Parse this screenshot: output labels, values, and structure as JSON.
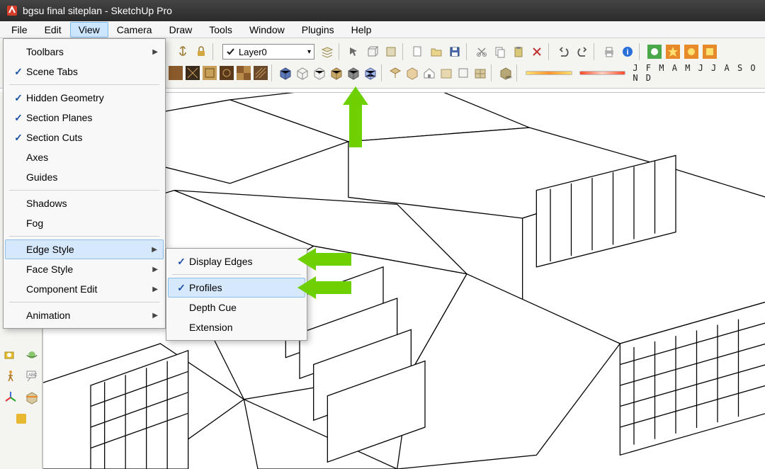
{
  "titlebar": {
    "text": "bgsu final siteplan - SketchUp Pro"
  },
  "menubar": {
    "items": [
      "File",
      "Edit",
      "View",
      "Camera",
      "Draw",
      "Tools",
      "Window",
      "Plugins",
      "Help"
    ],
    "active": "View"
  },
  "layer": {
    "selected": "Layer0"
  },
  "months": "J F M A M J J A S O N D",
  "view_menu": {
    "items": [
      {
        "label": "Toolbars",
        "checked": false,
        "submenu": true
      },
      {
        "label": "Scene Tabs",
        "checked": true
      },
      {
        "sep": true
      },
      {
        "label": "Hidden Geometry",
        "checked": true
      },
      {
        "label": "Section Planes",
        "checked": true
      },
      {
        "label": "Section Cuts",
        "checked": true
      },
      {
        "label": "Axes",
        "checked": false
      },
      {
        "label": "Guides",
        "checked": false
      },
      {
        "sep": true
      },
      {
        "label": "Shadows",
        "checked": false
      },
      {
        "label": "Fog",
        "checked": false
      },
      {
        "sep": true
      },
      {
        "label": "Edge Style",
        "checked": false,
        "submenu": true,
        "hover": true
      },
      {
        "label": "Face Style",
        "checked": false,
        "submenu": true
      },
      {
        "label": "Component Edit",
        "checked": false,
        "submenu": true
      },
      {
        "sep": true
      },
      {
        "label": "Animation",
        "checked": false,
        "submenu": true
      }
    ]
  },
  "edge_submenu": {
    "items": [
      {
        "label": "Display Edges",
        "checked": true
      },
      {
        "sep": true
      },
      {
        "label": "Profiles",
        "checked": true,
        "hover": true
      },
      {
        "label": "Depth Cue",
        "checked": false
      },
      {
        "label": "Extension",
        "checked": false
      }
    ]
  },
  "toolbar_row1_icons": [
    "anchor",
    "lock",
    "sel1",
    "sel2",
    "sel3",
    "sel4",
    "sel5"
  ],
  "toolbar_row2_icons": [
    "face1",
    "face2",
    "face3",
    "face4",
    "face5",
    "face6",
    "face7",
    "style1",
    "style2",
    "style3",
    "style4",
    "style5",
    "style6",
    "comp1",
    "comp2",
    "comp3",
    "comp4",
    "comp5",
    "comp6",
    "comp7"
  ]
}
